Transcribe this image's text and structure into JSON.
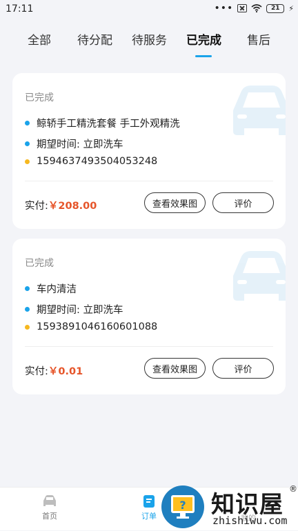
{
  "statusbar": {
    "time": "17:11",
    "battery": "21"
  },
  "tabs": [
    "全部",
    "待分配",
    "待服务",
    "已完成",
    "售后"
  ],
  "active_tab": 3,
  "orders": [
    {
      "status": "已完成",
      "service": "鲸轿手工精洗套餐 手工外观精洗",
      "time_label": "期望时间: 立即洗车",
      "order_no": "1594637493504053248",
      "paid_label": "实付:",
      "price": "￥208.00",
      "btn_effect": "查看效果图",
      "btn_rate": "评价"
    },
    {
      "status": "已完成",
      "service": "车内清洁",
      "time_label": "期望时间: 立即洗车",
      "order_no": "1593891046160601088",
      "paid_label": "实付:",
      "price": "￥0.01",
      "btn_effect": "查看效果图",
      "btn_rate": "评价"
    }
  ],
  "bottom_nav": {
    "home": "首页",
    "orders": "订单",
    "mine": "我的"
  },
  "watermark": {
    "cn": "知识屋",
    "py": "zhishiwu.com",
    "reg": "®"
  },
  "colors": {
    "accent": "#1aa3ea",
    "price": "#e6552a",
    "dot_yellow": "#f6b820"
  }
}
